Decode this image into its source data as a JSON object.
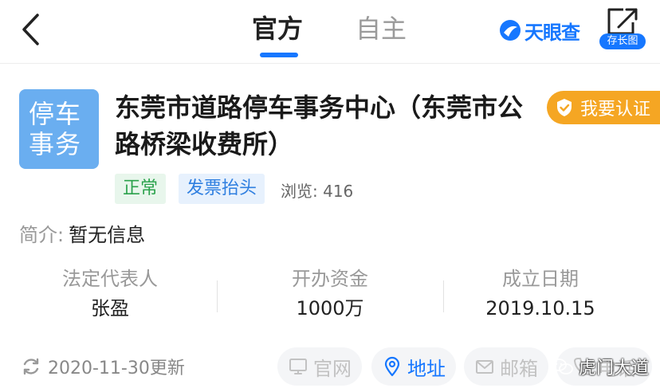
{
  "header": {
    "tabs": [
      {
        "label": "官方",
        "active": true
      },
      {
        "label": "自主",
        "active": false
      }
    ],
    "brand": "天眼查",
    "long_image_label": "存长图",
    "accent_color": "#1677ff"
  },
  "company": {
    "logo_text": [
      "停车",
      "事务"
    ],
    "name": "东莞市道路停车事务中心（东莞市公路桥梁收费所）",
    "certify_label": "我要认证",
    "status_tag": "正常",
    "invoice_tag": "发票抬头",
    "views": "浏览: 416",
    "intro_label": "简介:",
    "intro_value": "暂无信息"
  },
  "stats": [
    {
      "label": "法定代表人",
      "value": "张盈"
    },
    {
      "label": "开办资金",
      "value": "1000万"
    },
    {
      "label": "成立日期",
      "value": "2019.10.15"
    }
  ],
  "footer": {
    "updated": "2020-11-30更新",
    "actions": [
      {
        "label": "官网",
        "icon": "monitor-icon",
        "enabled": false
      },
      {
        "label": "地址",
        "icon": "location-pin-icon",
        "enabled": true
      },
      {
        "label": "邮箱",
        "icon": "mail-icon",
        "enabled": false
      },
      {
        "label": "电话",
        "icon": "phone-icon",
        "enabled": false
      }
    ],
    "watermark": "虎门大道"
  }
}
